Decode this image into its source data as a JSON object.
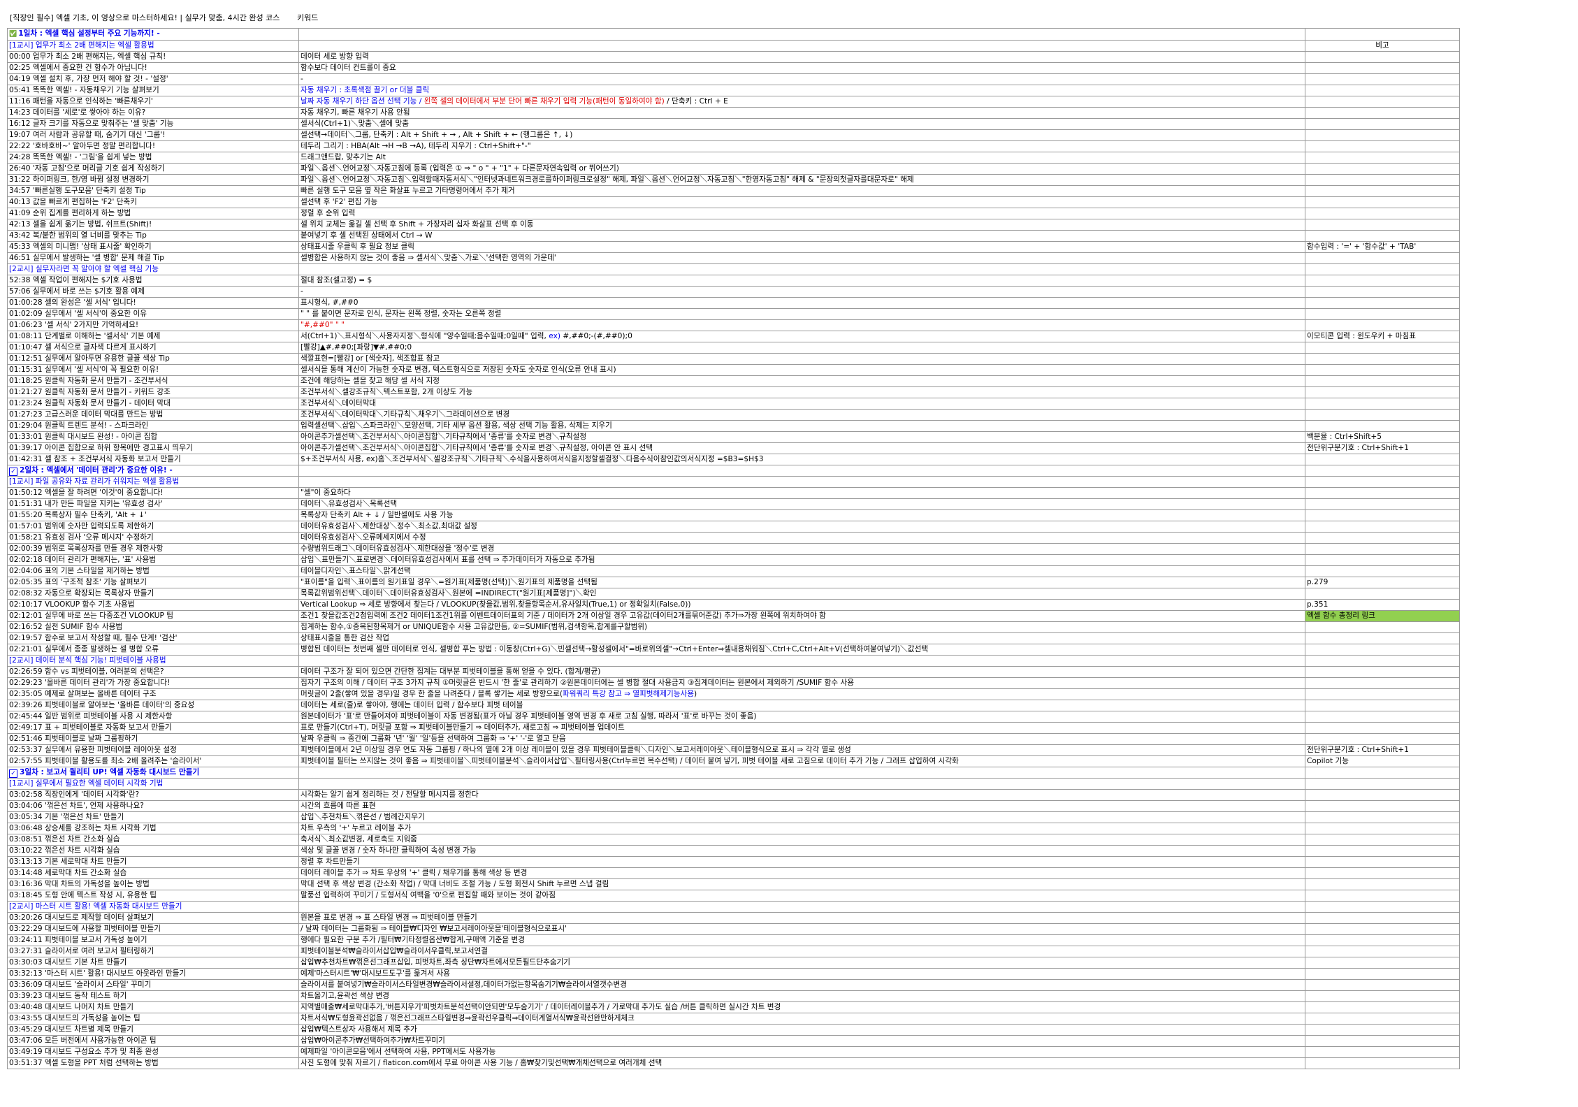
{
  "header": {
    "title": "[직장인 필수] 엑셀 기초, 이 영상으로 마스터하세요! | 실무가 맞춤, 4시간 완성 코스",
    "keyword_label": "키워드"
  },
  "rows": [
    {
      "type": "day",
      "c1": "1일차 : 엑셀 핵심 설정부터 주요 기능까지! -",
      "c2": "",
      "c3": ""
    },
    {
      "type": "section",
      "c1": "[1교시] 업무가 최소 2배 편해지는 엑셀 활용법",
      "c2": "",
      "c3": "비고",
      "c3_center": true
    },
    {
      "c1": "00:00 업무가 최소 2배 편해지는, 엑셀 핵심 규칙!",
      "c2": "데이터 세로 방향 입력",
      "c3": ""
    },
    {
      "c1": "02:25 엑셀에서 중요한 건 함수가 아닙니다!",
      "c2": "함수보다 데이터 컨트롤이 중요",
      "c3": ""
    },
    {
      "c1": "04:19 엑셀 설치 후, 가장 먼저 해야 할 것! - '설정'",
      "c2": "-",
      "c3": ""
    },
    {
      "c1": "05:41 똑똑한 엑셀! - 자동채우기 기능 살펴보기",
      "c2": "자동 채우기 : 초록색점 끌기 or 더블 클릭",
      "c2_class": "blue",
      "c3": ""
    },
    {
      "c1": "11:16 패턴을 자동으로 인식하는 '빠른채우기'",
      "c2_parts": [
        {
          "text": "날짜 자동 채우기 하단 옵션 선택 기능 / ",
          "cls": "blue"
        },
        {
          "text": "왼쪽 셀의 데이터에서 부분 단어 빠른 채우기 입력 기능(패턴이 동일하여야 함)",
          "cls": "red"
        },
        {
          "text": " / 단축키 : Ctrl + E",
          "cls": ""
        }
      ],
      "c3": ""
    },
    {
      "c1": "14:23 데이터를 '세로'로 쌓아야 하는 이유?",
      "c2": "자동 채우기, 빠른 채우기 사용 안됨",
      "c3": ""
    },
    {
      "c1": "16:12 글자 크기를 자동으로 맞춰주는 '셀 맞춤' 기능",
      "c2": "셀서식(Ctrl+1)＼맞춤＼셀에 맞춤",
      "c3": ""
    },
    {
      "c1": "19:07 여러 사람과 공유할 때, 숨기기 대신 '그룹'!",
      "c2": "셀선택→데이터＼그룹, 단축키 : Alt + Shift + →  , Alt + Shift + ← (행그룹은 ↑, ↓)",
      "c3": ""
    },
    {
      "c1": "22:22 '호바호바~' 알아두면 정말 편리합니다!",
      "c2": "테두리 그리기 : HBA(Alt →H →B →A), 테두리 지우기 : Ctrl+Shift+\"-\"",
      "c3": ""
    },
    {
      "c1": "24:28 똑똑한 엑셀! - '그림'을 쉽게 넣는 방법",
      "c2": "드래그앤드랍, 맞추기는 Alt",
      "c3": ""
    },
    {
      "c1": "26:40 '자동 고침'으로 머리글 기호 쉽게 작성하기",
      "c2": "파일＼옵션＼언어교정＼자동고침에 등록 (입력은 ① ⇒ \" o \" + \"1\" + 다른문자연속입력 or 뛰어쓰기)",
      "c3": ""
    },
    {
      "c1": "31:22 하이퍼링크, 한/영 바뀜 설정 변경하기",
      "c2": "파일＼옵션＼언어교정＼자동고침＼입력할때자동서식＼\"인터넷과네트워크경로를하이퍼링크로설정\" 해제, 파일＼옵션＼언어교정＼자동고침＼\"한영자동고침\" 해제 & \"문장의첫글자를대문자로\" 해제",
      "c3": ""
    },
    {
      "c1": "34:57 '빠른실행 도구모음' 단축키 설정 Tip",
      "c2": "빠른 실행 도구 모음 옆 작은 화살표 누르고 기타명령어에서 추가 제거",
      "c3": ""
    },
    {
      "c1": "40:13 값을 빠르게 편집하는 'F2' 단축키",
      "c2": "셀선택 후 'F2' 편집 가능",
      "c3": ""
    },
    {
      "c1": "41:09 순위 집계를 편리하게 하는 방법",
      "c2": "정렬 후 순위 입력",
      "c3": ""
    },
    {
      "c1": "42:13 셀을 쉽게 옮기는 방법, 쉬프트(Shift)!",
      "c2": "셀 위치 교체는 옮길 셀 선택 후 Shift + 가장자리 십자 화살표 선택 후 이동",
      "c3": ""
    },
    {
      "c1": "43:42 복/붙한 범위의 열 너비를 맞추는 Tip",
      "c2": "붙여넣기 후 셀 선택된 상태에서 Ctrl → W",
      "c3": ""
    },
    {
      "c1": "45:33 엑셀의 미니맵! '상태 표시줄' 확인하기",
      "c2": "상태표시줄 우클릭 후 필요 정보 클릭",
      "c3": "함수입력 : '=' + '함수값' + 'TAB'"
    },
    {
      "c1": "46:51 실무에서 발생하는 '셀 병합' 문제 해결 Tip",
      "c2": "셀병합은 사용하지 않는 것이 좋음 ⇒ 셀서식＼맞춤＼가로＼'선택한 영역의 가운데'",
      "c3": ""
    },
    {
      "type": "section",
      "c1": "[2교시] 실무자라면 꼭 알아야 할 엑셀 핵심 기능",
      "c2": "",
      "c3": ""
    },
    {
      "c1": "52:38 엑셀 작업이 편해지는 $기호 사용법",
      "c2": "절대 참조(셀고정) = $",
      "c3": ""
    },
    {
      "c1": "57:06 실무에서 바로 쓰는 $기호 활용 예제",
      "c2": "-",
      "c3": ""
    },
    {
      "c1": "01:00:28 셀의 완성은 '셀 서식' 입니다!",
      "c2": "표시형식, #,##0",
      "c3": ""
    },
    {
      "c1": "01:02:09 실무에서 '셀 서식'이 중요한 이유",
      "c2": "\" \" 를 붙이면 문자로 인식, 문자는 왼쪽 정렬, 숫자는 오른쪽 정렬",
      "c3": ""
    },
    {
      "c1": "01:06:23 '셀 서식' 2가지만 기억하세요!",
      "c2": "\"#,##0\" \" \"",
      "c2_class": "red",
      "c3": ""
    },
    {
      "c1": "01:08:11 단계별로 이해하는 '셀서식' 기본 예제",
      "c2_parts": [
        {
          "text": "서(Ctrl+1)＼표시형식＼사용자지정＼형식에 \"양수일때;음수일때;0일때\" 입력, ",
          "cls": ""
        },
        {
          "text": "ex)",
          "cls": "blue"
        },
        {
          "text": " #,##0;-(#,##0);0",
          "cls": ""
        }
      ],
      "c3": "이모티콘 입력 : 윈도우키 + 마침표"
    },
    {
      "c1": "01:10:47 셀 서식으로 글자색 다르게 표시하기",
      "c2": "[빨강]▲#,##0;[파랑]▼#,##0;0",
      "c3": ""
    },
    {
      "c1": "01:12:51 실무에서 알아두면 유용한 글꼴 색상 Tip",
      "c2": "색깔표현=[빨강] or [색숫자], 색조합표 참고",
      "c3": ""
    },
    {
      "c1": "01:15:31 실무에서 '셀 서식'이 꼭 필요한 이유!",
      "c2": "셀서식을 통해 계산이 가능한 숫자로 변경, 텍스트형식으로 저장된 숫자도 숫자로 인식(오류 안내 표시)",
      "c3": ""
    },
    {
      "c1": "01:18:25 원클릭 자동화 문서 만들기 - 조건부서식",
      "c2": "조건에 해당하는 셀을 찾고 해당 셀 서식 지정",
      "c3": ""
    },
    {
      "c1": "01:21:27 원클릭 자동화 문서 만들기 - 키워드 강조",
      "c2": "조건부서식＼셀강조규칙＼텍스트포함, 2개 이상도 가능",
      "c3": ""
    },
    {
      "c1": "01:23:24 원클릭 자동화 문서 만들기 - 데이터 막대",
      "c2": "조건부서식＼데이터막대",
      "c3": ""
    },
    {
      "c1": "01:27:23 고급스러운 데이터 막대를 만드는 방법",
      "c2": "조건부서식＼데이터막대＼기타규칙＼채우기＼그라데이션으로 변경",
      "c3": ""
    },
    {
      "c1": "01:29:04 원클릭 트렌드 분석! - 스파크라인",
      "c2": "입력셀선택＼삽입＼스파크라인＼모양선택, 기타 세부 옵션 활용, 색상 선택 기능 활용, 삭제는 지우기",
      "c3": ""
    },
    {
      "c1": "01:33:01 원클릭 대시보드 완성! - 아이콘 집합",
      "c2": "아이콘추가셀선택＼조건부서식＼아이콘집합＼기타규칙에서 '종류'를 숫자로 변경＼규칙설정",
      "c3": "백분율 : Ctrl+Shift+5"
    },
    {
      "c1": "01:39:17 아이콘 집합으로 하위 항목에만 경고표시 띄우기",
      "c2": "아이콘추가셀선택＼조건부서식＼아이콘집합＼기타규칙에서 '종류'를 숫자로 변경＼규칙설정, 아이콘 안 표시 선택",
      "c3": "전단위구분기호 : Ctrl+Shift+1"
    },
    {
      "c1": "01:42:31 셀 참조 + 조건부서식 자동화 보고서 만들기",
      "c2": "$+조건부서식 사용, ex)홈＼조건부서식＼셀강조규칙＼기타규칙＼수식을사용하여서식을지정할셀결정＼다음수식이참인값의서식지정 =$B3=$H$3",
      "c3": ""
    },
    {
      "type": "day",
      "chk": true,
      "c1": "2일차 : 엑셀에서 '데이터 관리'가 중요한 이유! -",
      "c2": "",
      "c3": ""
    },
    {
      "type": "section",
      "c1": "[1교시] 파일 공유와 자료 관리가 쉬워지는 엑셀 활용법",
      "c2": "",
      "c3": ""
    },
    {
      "c1": "01:50:12 엑셀을 잘 하려면 '이것'이 중요합니다!",
      "c2": "\"셀\"이 중요하다",
      "c3": ""
    },
    {
      "c1": "01:51:31 내가 만든 파일을 지키는 '유효성 검사'",
      "c2": "데이터＼유효성검사＼목록선택",
      "c3": ""
    },
    {
      "c1": "01:55:20 목록상자 필수 단축키, 'Alt + ↓'",
      "c2": "목록상자 단축키 Alt + ↓ / 일반셀에도 사용 가능",
      "c3": ""
    },
    {
      "c1": "01:57:01 범위에 숫자만 입력되도록 제한하기",
      "c2": "데이터유효성검사＼제한대상＼정수＼최소값,최대값 설정",
      "c3": ""
    },
    {
      "c1": "01:58:21 유효성 검사 '오류 메시지' 수정하기",
      "c2": "데이터유효성검사＼오류메세지에서 수정",
      "c3": ""
    },
    {
      "c1": "02:00:39 범위로 목록상자를 만들 경우 제한사항",
      "c2": "수량범위드래그＼데이터유효성검사＼제한대상을 '정수'로 변경",
      "c3": ""
    },
    {
      "c1": "02:02:18 데이터 관리가 편해지는, '표' 사용법",
      "c2": "삽입＼표만들기＼표로변경＼데이터유효성검사에서 표를 선택 ⇒ 추가데이터가 자동으로 추가됨",
      "c3": ""
    },
    {
      "c1": "02:04:06 표의 기본 스타일을 제거하는 방법",
      "c2": "테이블디자인＼표스타일＼맑게선택",
      "c3": ""
    },
    {
      "c1": "02:05:35 표의 '구조적 참조' 기능 살펴보기",
      "c2": "\"표이름\"을 입력＼표이름의 원기표일 경우＼=원기표[제품명(선택)]＼원기표의 제품명을 선택됨",
      "c3": "p.279"
    },
    {
      "c1": "02:08:32 자동으로 확장되는 목록상자 만들기",
      "c2": "목록값위범위선택＼데이터＼데이터유효성검사＼원본에 =INDIRECT(\"원기표[제품명]\")＼확인",
      "c3": ""
    },
    {
      "c1": "02:10:17 VLOOKUP 함수 기초 사용법",
      "c2": "Vertical Lookup ⇒ 세로 방향에서 찾는다 / VLOOKUP(찾을값,범위,찾을항목순서,유사일치(True,1) or 정확일치(False,0))",
      "c3": "p.351"
    },
    {
      "c1": "02:12:01 실무에 바로 쓰는 다중조건 VLOOKUP 팁",
      "c2": "조건1 찾을값조건2첨입력에 조건2 데이터1조건1위를 이벤트데이터표의 기준 / 데이터가 2개 이상일 경우 고유값(데이터2개를묶어준값) 추가⇒가장 왼쪽에 위치하여야 함",
      "c3": "엑셀 함수 총정리 링크",
      "c3_green": true
    },
    {
      "c1": "02:16:52 실전 SUMIF 함수 사용법",
      "c2": "집계하는 함수,①중복된항목제거 or UNIQUE함수 사용 고유값만듬, ②=SUMIF(범위,검색항목,합계를구할범위)",
      "c3": ""
    },
    {
      "c1": "02:19:57 함수로 보고서 작성할 때, 필수 단계! '검산'",
      "c2": "상태표시줄을 통한 검산 작업",
      "c3": ""
    },
    {
      "c1": "02:21:01 실무에서 종종 발생하는 셀 병합 오류",
      "c2": "병합된 데이터는 첫번째 셀만 데이터로 인식, 셀병합 푸는 방법 : 이동창(Ctrl+G)＼빈셀선택→활성셀에서\"=바로위의셀\"→Ctrl+Enter⇒셀내용채워짐＼Ctrl+C,Ctrl+Alt+V(선택하여붙여넣기)＼값선택",
      "c3": ""
    },
    {
      "type": "section",
      "c1": "[2교시] 데이터 분석 핵심 기능! 피벗테이블 사용법",
      "c2": "",
      "c3": ""
    },
    {
      "c1": "02:26:59 함수 vs 피벗테이블, 여러분의 선택은?",
      "c2": "데이터 구조가 잘 되어 있으면 간단한 집계는 대부분 피벗테이블을 통해 얻을 수 있다. (합계/평균)",
      "c3": ""
    },
    {
      "c1": "02:29:23 '올바른 데이터 관리'가 가장 중요합니다!",
      "c2": "집자기 구조의 이해 / 데이터 구조 3가지 규칙 ①머릿글은 반드시 '한 줄'로 관리하기 ②원본데이터에는 셀 병합 절대 사용금지 ③집계데이터는 원본에서 제외하기 /SUMIF 함수 사용",
      "c3": ""
    },
    {
      "c1": "02:35:05 예제로 살펴보는 올바른 데이터 구조",
      "c2_parts": [
        {
          "text": "머릿글이 2줄(쌓여 있을 경우)일 경우 한 줄을 나려준다 / 블록 쌓기는 세로 방향으로(",
          "cls": ""
        },
        {
          "text": "파워쿼리 특강 참고 ⇒ 열피벗해제기능사용",
          "cls": "blue"
        },
        {
          "text": ")",
          "cls": ""
        }
      ],
      "c3": ""
    },
    {
      "c1": "02:39:26 피벗테이블로 알아보는 '올바른 데이터'의 중요성",
      "c2": "데이터는 세로(줄)로 쌓아야, 행에는 데이터 입력 / 함수보다 피벗 테이블",
      "c3": ""
    },
    {
      "c1": "02:45:44 일반 범위로 피벗테이블 사용 시 제한사항",
      "c2": "원본데이터가 '표'로 만들어져야 피벗테이블이 자동 변경됨(표가 아닐 경우 피벗테이블 영역 변경 후 새로 고침 실행, 따라서 '표'로 바꾸는 것이 좋음)",
      "c3": ""
    },
    {
      "c1": "02:49:17 표 + 피벗테이블로 자동화 보고서 만들기",
      "c2": "표로 만들기(Ctrl+T), 머릿글 포함 ⇒ 피벗테이블만들기 ⇒ 데이터추가, 새로고침 ⇒ 피벗테이블 업데이트",
      "c3": ""
    },
    {
      "c1": "02:51:46 피벗테이블로 날짜 그룹핑하기",
      "c2": "날짜 우클릭 ⇒ 중간에 그룹화 '년' '월' '일'등을 선택하여 그룹화 ⇒ '+' '-'로 열고 닫음",
      "c3": ""
    },
    {
      "c1": "02:53:37 실무에서 유용한 피벗테이블 레이아웃 설정",
      "c2": "피벗테이블에서 2년 이상일 경우 연도 자동 그룹핑 / 하나의 열에 2개 이상 레이블이 있을 경우 피벗테이블클릭＼디자인＼보고서레이아웃＼테이블형식으로 표시 ⇒ 각각 열로 생성",
      "c3": "전단위구분기호 : Ctrl+Shift+1"
    },
    {
      "c1": "02:57:55 피벗테이블 활용도를 최소 2배 올려주는 '슬라이서'",
      "c2": "피벗테이블 필터는 쓰지않는 것이 좋음 ⇒ 피벗테이블＼피벗테이블분석＼슬라이서삽입＼필터링사용(Ctrl누르면 복수선택) / 데이터 붙여 넣기, 피벗 테이블 새로 고침으로 데이터 추가 기능 / 그래프 삽입하여 시각화",
      "c3": "Copilot 기능"
    },
    {
      "type": "day",
      "chk": true,
      "c1": "3일차 : 보고서 퀄리티 UP! 엑셀 자동화 대시보드 만들기",
      "c2": "",
      "c3": ""
    },
    {
      "type": "section",
      "c1": "[1교시] 실무에서 필요한 엑셀 데이터 시각화 기법",
      "c2": "",
      "c3": ""
    },
    {
      "c1": "03:02:58 직장인에게 '데이터 시각화'란?",
      "c2": "시각화는 알기 쉽게 정리하는 것 / 전달할 메시지를 정한다",
      "c3": ""
    },
    {
      "c1": "03:04:06 '꺾은선 차트', 언제 사용하나요?",
      "c2": "시간의 흐름에 따른 표현",
      "c3": ""
    },
    {
      "c1": "03:05:34 기본 '꺾은선 차트' 만들기",
      "c2": "삽입＼추천차트＼꺾은선 / 범례간지우기",
      "c3": ""
    },
    {
      "c1": "03:06:48 상승세를 강조하는 차트 시각화 기법",
      "c2": "차트 우측의 '+' 누르고 레이블 추가",
      "c3": ""
    },
    {
      "c1": "03:08:51 꺾은선 차트 간소화 실습",
      "c2": "축서식＼최소값변경, 세로축도 지워줌",
      "c3": ""
    },
    {
      "c1": "03:10:22 꺾은선 차트 시각화 실습",
      "c2": "색상 및 글꼴 변경 / 숫자 하나만 클릭하여 속성 변경 가능",
      "c3": ""
    },
    {
      "c1": "03:13:13 기본 세로막대 차트 만들기",
      "c2": "정렬 후 차트만들기",
      "c3": ""
    },
    {
      "c1": "03:14:48 세로막대 차트 간소화 실습",
      "c2": "데이터 레이블 추가 ⇒ 차트 우상의 '+' 클릭 / 채우기를 통해 색상 등 변경",
      "c3": ""
    },
    {
      "c1": "03:16:36 막대 차트의 가독성을 높이는 방법",
      "c2": "막대 선택 후 색상 변경 (간소화 작업) / 막대 너비도 조절 가능 / 도형 회전시 Shift 누르면 스냅 걸림",
      "c3": ""
    },
    {
      "c1": "03:18:45 도형 안에 텍스트 작성 시, 유용한 팁",
      "c2": "말풍선 입력하여 꾸미기 / 도형서식 여백을 '0'으로 편집할 때와 보이는 것이 같아짐",
      "c3": ""
    },
    {
      "type": "section",
      "c1": "[2교시] 마스터 시트 활용! 엑셀 자동화 대시보드 만들기",
      "c2": "",
      "c3": ""
    },
    {
      "c1": "03:20:26 대시보드로 제작할 데이터 살펴보기",
      "c2": "원본을 표로 변경 ⇒ 표 스타일 변경 ⇒ 피벗테이블 만들기",
      "c3": ""
    },
    {
      "c1": "03:22:29 대시보드에 사용할 피벗테이블 만들기",
      "c2": "/ 날짜 데이터는 그룹화됨 ⇒ 테이블₩디자인 ₩보고서레이아웃을'테이블형식으로표시'",
      "c3": ""
    },
    {
      "c1": "03:24:11 피벗테이블 보고서 가독성 높이기",
      "c2": "행에다 필요한 구분 추가 /필터₩기타정렬옵션₩합계,구매액 기준을 변경",
      "c3": ""
    },
    {
      "c1": "03:27:31 슬라이서로 여러 보고서 필터링하기",
      "c2": "피벗테이블분석₩슬라이서삽입₩슬라이서우클릭,보고서연결",
      "c3": ""
    },
    {
      "c1": "03:30:03 대시보드 기본 차트 만들기",
      "c2": "삽입₩추천차트₩꺾은선그래프삽입, 피벗차트,좌측 상단₩차트에서모든필드단추숨기기",
      "c3": ""
    },
    {
      "c1": "03:32:13 '마스터 시트' 활용! 대시보드 아웃라인 만들기",
      "c2": "예제'마스터시트'₩'대시보드도구'를 옮겨서 사용",
      "c3": ""
    },
    {
      "c1": "03:36:09 대시보드 '슬라이서 스타일' 꾸미기",
      "c2": "슬라이서를 붙여넣기₩슬라이서스타일변경₩슬라이서설정,데이터가없는항목숨기기₩슬라이서열갯수변경",
      "c3": ""
    },
    {
      "c1": "03:39:23 대시보드 동작 테스트 하기",
      "c2": "차트옮기고,윤곽선 색상 변경",
      "c3": ""
    },
    {
      "c1": "03:40:48 대시보드 나머지 차트 만들기",
      "c2": "지역별매출₩세로막대추가,'버튼지우기'피벗차트분석선택이안되면'모두숨기기' / 데이터레이블추가 / 가로막대 추가도 실습 /버튼 클릭하면 실시간 차트 변경",
      "c3": ""
    },
    {
      "c1": "03:43:55 대시보드의 가독성을 높이는 팁",
      "c2": "차트서식₩도형윤곽선없음 / 꺾은선그래프스타일변경⇒윤곽선우클릭⇒데이터계열서식₩윤곽선완만하게체크",
      "c3": ""
    },
    {
      "c1": "03:45:29 대시보드 차트별 제목 만들기",
      "c2": "삽입₩텍스트상자 사용해서 제목 추가",
      "c3": ""
    },
    {
      "c1": "03:47:06 모든 버전에서 사용가능한 아이콘 팁",
      "c2": "삽입₩아이콘추가₩선택하여추가₩차트꾸미기",
      "c3": ""
    },
    {
      "c1": "03:49:19 대시보드 구성요소 추가 및 최종 완성",
      "c2": "예제파일 '아이콘모음'에서 선택하여 사용, PPT에서도 사용가능",
      "c3": ""
    },
    {
      "c1": "03:51:37 엑셀 도형을 PPT 처럼 선택하는 방법",
      "c2": "사진 도형에 맞춰 자르기 / flaticon.com에서 무료 아이콘 사용 기능 / 홈₩찾기및선택₩개체선택으로 여러개체 선택",
      "c3": ""
    }
  ]
}
